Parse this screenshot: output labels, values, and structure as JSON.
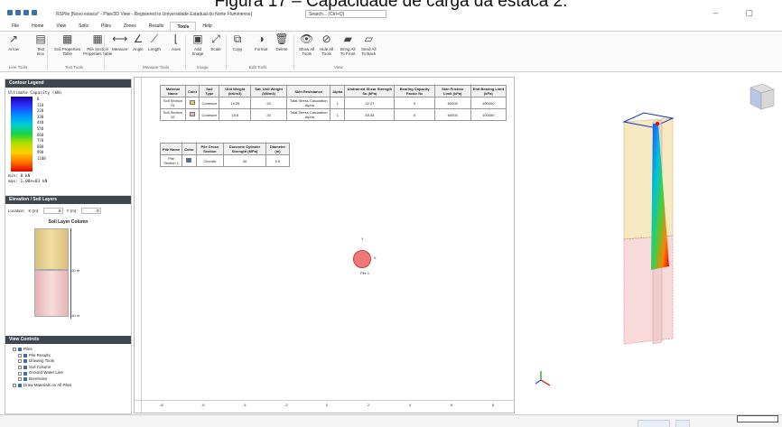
{
  "caption": "Figura 17 – Capacidade de carga da estaca 2.",
  "window": {
    "title": "RSPile  [Novo estaca* - Plan/3D View - Registered to Universidade Estadual do Norte Fluminense]",
    "search_placeholder": "Search... (Ctrl+Q)"
  },
  "menu": [
    "File",
    "Home",
    "View",
    "Soils",
    "Piles",
    "Zones",
    "Results",
    "Tools",
    "Help"
  ],
  "menu_active": "Tools",
  "ribbon": {
    "buttons": [
      {
        "label": "Arrow",
        "icon": "arrow-icon"
      },
      {
        "label": "Text\nBox",
        "icon": "textbox-icon"
      },
      {
        "label": "Soil Properties\nTable",
        "icon": "table-icon"
      },
      {
        "label": "Pile Section\nProperties Table",
        "icon": "table-icon"
      },
      {
        "label": "Measure",
        "icon": "measure-icon"
      },
      {
        "label": "Angle",
        "icon": "angle-icon"
      },
      {
        "label": "Length",
        "icon": "length-icon"
      },
      {
        "label": "Axes",
        "icon": "axes-icon"
      },
      {
        "label": "Add\nImage",
        "icon": "image-icon"
      },
      {
        "label": "Scale",
        "icon": "scale-icon"
      },
      {
        "label": "Copy",
        "icon": "copy-icon"
      },
      {
        "label": "Format",
        "icon": "format-icon"
      },
      {
        "label": "Delete",
        "icon": "delete-icon"
      },
      {
        "label": "Show All\nTools",
        "icon": "eye-icon"
      },
      {
        "label": "Hide All\nTools",
        "icon": "hide-icon"
      },
      {
        "label": "Bring All\nTo Front",
        "icon": "bring-front-icon"
      },
      {
        "label": "Send All\nTo Back",
        "icon": "send-back-icon"
      }
    ],
    "groups": [
      "Line Tools",
      "Text Tools",
      "Measure Tools",
      "Image",
      "Edit Tools",
      "View"
    ]
  },
  "contour_legend": {
    "header": "Contour Legend",
    "title": "Ultimate Capacity (kN)",
    "ticks": [
      "0",
      "110",
      "220",
      "330",
      "440",
      "550",
      "660",
      "770",
      "880",
      "990",
      "1100"
    ],
    "min": "min: 0 kN",
    "max": "max: 1.00e+03 kN"
  },
  "elevation": {
    "header": "Elevation / Soil Layers",
    "location_label": "Location:",
    "x_label": "X (m):",
    "x_value": "0",
    "y_label": "Y (m):",
    "y_value": "0",
    "column_title": "Soil Layer Column",
    "depth_mid": "-20 m",
    "depth_bottom": "-40 m"
  },
  "view_controls": {
    "header": "View Controls",
    "items": [
      "Piles",
      "Pile Results",
      "Drawing Tools",
      "Soil Column",
      "Ground Water Line",
      "Boreholes",
      "Draw Materials on All Piles"
    ]
  },
  "soil_table": {
    "headers": [
      "Material Name",
      "Color",
      "Soil Type",
      "Unit Weight (kN/m3)",
      "Sat. Unit Weight (kN/m3)",
      "Skin Resistance",
      "Alpha",
      "Undrained Shear Strength Su (kPa)",
      "Bearing Capacity Factor Nc",
      "Skin Friction Limit (kPa)",
      "End Bearing Limit (kPa)"
    ],
    "rows": [
      {
        "name": "Soil Section 01",
        "color": "#e8c668",
        "type": "Cohesive",
        "uw": "14.25",
        "suw": "20",
        "skin": "Total Stress Calculation - Alpha",
        "alpha": "1",
        "su": "22.27",
        "nc": "9",
        "sfl": "60000",
        "ebl": "100000"
      },
      {
        "name": "Soil Section 02",
        "color": "#f0b0b0",
        "type": "Cohesive",
        "uw": "15.5",
        "suw": "20",
        "skin": "Total Stress Calculation - Alpha",
        "alpha": "1",
        "su": "45.38",
        "nc": "9",
        "sfl": "60000",
        "ebl": "100000"
      }
    ]
  },
  "pile_table": {
    "headers": [
      "Pile Name",
      "Color",
      "Pile Cross Section",
      "Concrete Cylinder Strength (MPa)",
      "Diameter (m)"
    ],
    "rows": [
      {
        "name": "Pile Section 1",
        "color": "#3a6fb0",
        "section": "Circular",
        "fc": "40",
        "d": "0.5"
      }
    ]
  },
  "plan": {
    "pile_label": "Pile 1",
    "axis_x": "X",
    "axis_y": "Y",
    "ruler_ticks": [
      "-8",
      "-6",
      "-4",
      "-2",
      "0",
      "2",
      "4",
      "6",
      "8"
    ]
  }
}
